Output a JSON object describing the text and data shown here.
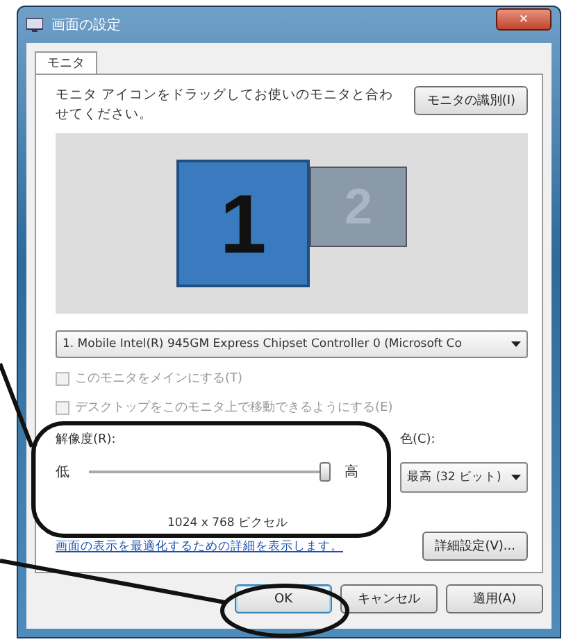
{
  "window": {
    "title": "画面の設定",
    "close": "×"
  },
  "tabs": [
    {
      "label": "モニタ",
      "selected": true
    }
  ],
  "instruction": "モニタ アイコンをドラッグしてお使いのモニタと合わせてください。",
  "identify_button": "モニタの識別(I)",
  "monitors": [
    {
      "label": "1",
      "selected": true
    },
    {
      "label": "2",
      "selected": false
    }
  ],
  "display_select": "1. Mobile Intel(R) 945GM Express Chipset Controller 0 (Microsoft Co",
  "checkboxes": [
    {
      "label": "このモニタをメインにする(T)",
      "checked": false,
      "disabled": true
    },
    {
      "label": "デスクトップをこのモニタ上で移動できるようにする(E)",
      "checked": false,
      "disabled": true
    }
  ],
  "resolution": {
    "label": "解像度(R):",
    "low": "低",
    "high": "高",
    "level": 1,
    "reading": "1024 x 768 ピクセル"
  },
  "color": {
    "label": "色(C):",
    "value": "最高 (32 ビット)"
  },
  "help_link": "画面の表示を最適化するための詳細を表示します。",
  "advanced_button": "詳細設定(V)...",
  "buttons": [
    {
      "label": "OK",
      "default": true
    },
    {
      "label": "キャンセル",
      "default": false
    },
    {
      "label": "適用(A)",
      "default": false
    }
  ],
  "annotations": [
    {
      "kind": "ellipse"
    },
    {
      "kind": "ellipse"
    }
  ]
}
